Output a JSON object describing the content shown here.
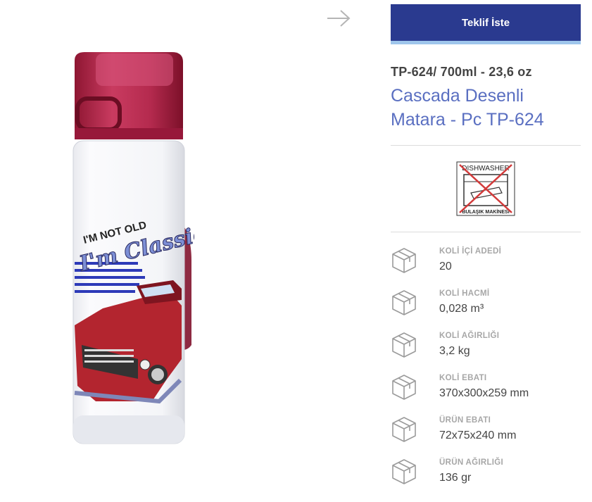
{
  "nav": {
    "next_icon": "arrow-right-icon"
  },
  "cta": {
    "label": "Teklif İste"
  },
  "product": {
    "code_line": "TP-624/ 700ml - 23,6 oz",
    "title_line1": "Cascada Desenli",
    "title_line2": "Matara - Pc TP-624",
    "image": {
      "slogan_top": "I'M NOT OLD",
      "slogan_main": "I'm Classic"
    }
  },
  "dishwasher": {
    "top_label": "DISHWASHER",
    "bottom_label": "BULAŞIK MAKİNESİ"
  },
  "specs": [
    {
      "icon": "box-icon",
      "label": "KOLİ İÇİ ADEDİ",
      "value": "20"
    },
    {
      "icon": "box-icon",
      "label": "KOLİ HACMİ",
      "value": "0,028 m³"
    },
    {
      "icon": "box-icon",
      "label": "KOLİ AĞIRLIĞI",
      "value": "3,2 kg"
    },
    {
      "icon": "box-icon",
      "label": "KOLİ EBATI",
      "value": "370x300x259 mm"
    },
    {
      "icon": "box-icon",
      "label": "ÜRÜN EBATI",
      "value": "72x75x240 mm"
    },
    {
      "icon": "box-icon",
      "label": "ÜRÜN AĞIRLIĞI",
      "value": "136 gr"
    }
  ],
  "colors": {
    "cta_bg": "#2a3a8f",
    "cta_border": "#9fc6ec",
    "title": "#5a6fc1",
    "cap": "#b8284d"
  }
}
